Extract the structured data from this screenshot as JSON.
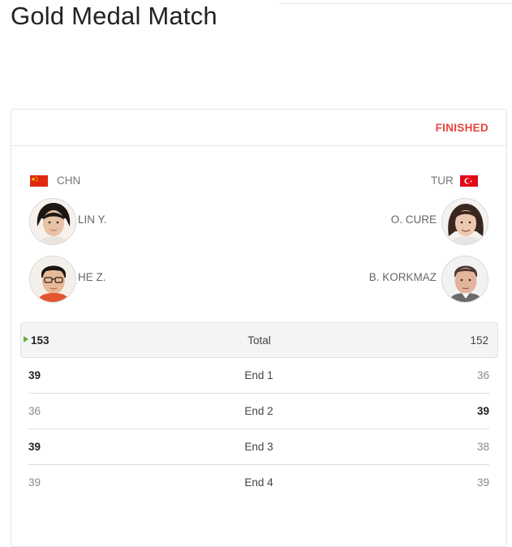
{
  "page": {
    "title": "Gold Medal Match"
  },
  "match": {
    "status": "FINISHED",
    "left_team": {
      "country": "CHN",
      "flag": "china-flag",
      "players": [
        "LIN Y.",
        "HE Z."
      ]
    },
    "right_team": {
      "country": "TUR",
      "flag": "turkey-flag",
      "players": [
        "O. CURE",
        "B. KORKMAZ"
      ]
    },
    "total": {
      "label": "Total",
      "left": "153",
      "right": "152",
      "winner": "left"
    },
    "ends": [
      {
        "label": "End 1",
        "left": "39",
        "right": "36",
        "winner": "left"
      },
      {
        "label": "End 2",
        "left": "36",
        "right": "39",
        "winner": "right"
      },
      {
        "label": "End 3",
        "left": "39",
        "right": "38",
        "winner": "left"
      },
      {
        "label": "End 4",
        "left": "39",
        "right": "39",
        "winner": "none"
      }
    ]
  },
  "colors": {
    "status": "#e8453c",
    "winner_marker": "#6aab3a",
    "border": "#e3e3e3"
  }
}
